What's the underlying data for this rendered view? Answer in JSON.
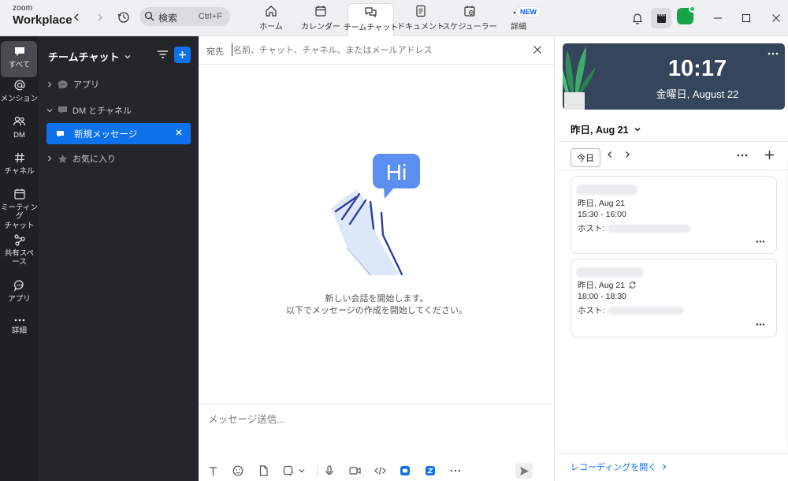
{
  "app": {
    "brand_line1": "zoom",
    "brand_line2": "Workplace"
  },
  "search": {
    "label": "検索",
    "shortcut": "Ctrl+F"
  },
  "tabs": [
    {
      "label": "ホーム",
      "icon": "home-icon"
    },
    {
      "label": "カレンダー",
      "icon": "calendar-icon"
    },
    {
      "label": "チームチャット",
      "icon": "chat-bubbles-icon",
      "active": true
    },
    {
      "label": "ドキュメント",
      "icon": "document-icon"
    },
    {
      "label": "スケジューラー",
      "icon": "scheduler-icon"
    },
    {
      "label": "詳細",
      "icon": "more-icon",
      "badge": "NEW"
    }
  ],
  "rail": [
    {
      "label": "すべて",
      "icon": "chat-icon",
      "active": true
    },
    {
      "label": "メンション",
      "icon": "at-icon"
    },
    {
      "label": "DM",
      "icon": "people-icon"
    },
    {
      "label": "チャネル",
      "icon": "hash-icon"
    },
    {
      "label": "ミーティング\nチャット",
      "icon": "meeting-chat-icon"
    },
    {
      "label": "共有スペース",
      "icon": "shared-space-icon"
    },
    {
      "label": "アプリ",
      "icon": "apps-icon"
    },
    {
      "label": "詳細",
      "icon": "more-icon"
    }
  ],
  "sidebar": {
    "title": "チームチャット",
    "sections": [
      {
        "label": "アプリ",
        "expanded": false
      },
      {
        "label": "DM とチャネル",
        "expanded": true
      },
      {
        "label": "お気に入り",
        "expanded": false
      }
    ],
    "active_item": "新規メッセージ"
  },
  "compose": {
    "to_label": "宛先",
    "to_placeholder": "名前、チャット、チャネル、またはメールアドレス",
    "hi_text": "Hi",
    "empty_line1": "新しい会話を開始します。",
    "empty_line2": "以下でメッセージの作成を開始してください。",
    "message_placeholder": "メッセージ送信..."
  },
  "clock": {
    "time": "10:17",
    "date": "金曜日, August 22"
  },
  "calendar": {
    "date_header": "昨日, Aug 21",
    "today_button": "今日",
    "events": [
      {
        "date": "昨日, Aug 21",
        "time": "15:30 - 16:00",
        "host_label": "ホスト:",
        "recurring": false
      },
      {
        "date": "昨日, Aug 21",
        "time": "18:00 - 18:30",
        "host_label": "ホスト:",
        "recurring": true
      }
    ],
    "recordings_link": "レコーディングを開く"
  },
  "colors": {
    "accent": "#0e72ed",
    "rail_bg": "#1f2024",
    "sidebar_bg": "#25262a",
    "clock_bg": "#34455c",
    "topbar_bg": "#f0f0f2"
  }
}
